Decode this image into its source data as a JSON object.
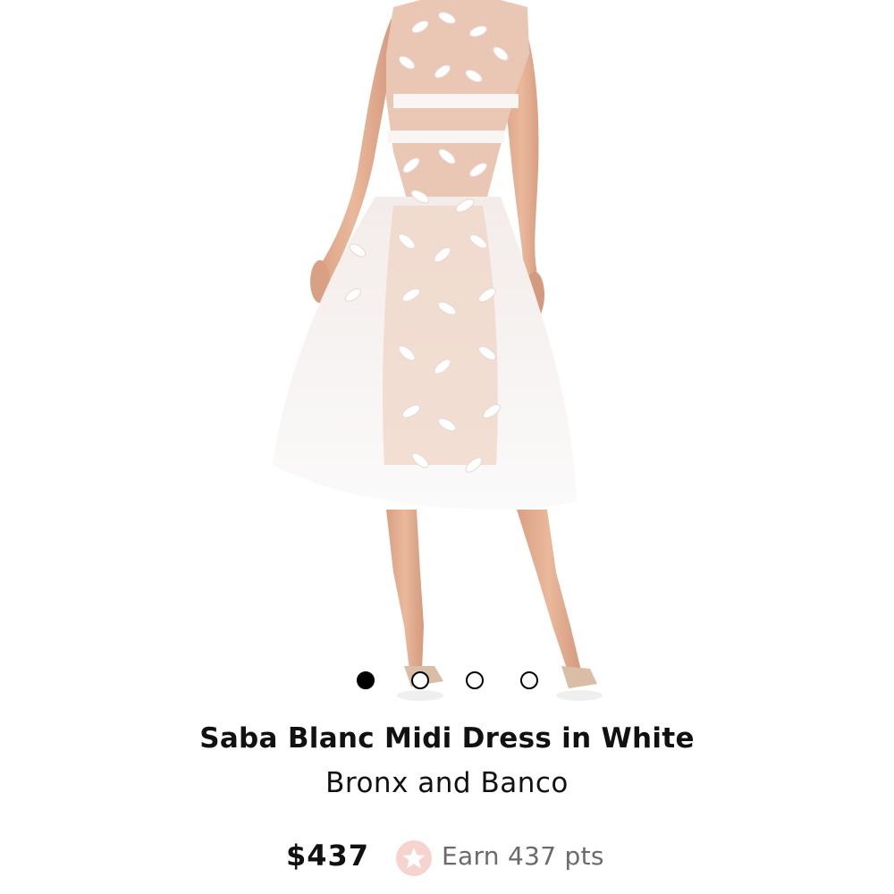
{
  "product": {
    "title": "Saba Blanc Midi Dress in White",
    "brand": "Bronx and Banco",
    "price": "$437",
    "points_label": "Earn 437 pts"
  },
  "gallery": {
    "total_images": 4,
    "active_index": 0
  },
  "icons": {
    "points": "star-icon"
  },
  "colors": {
    "points_badge": "#f6d3ce",
    "points_star": "#ffffff",
    "points_text": "#6b6b6b"
  }
}
